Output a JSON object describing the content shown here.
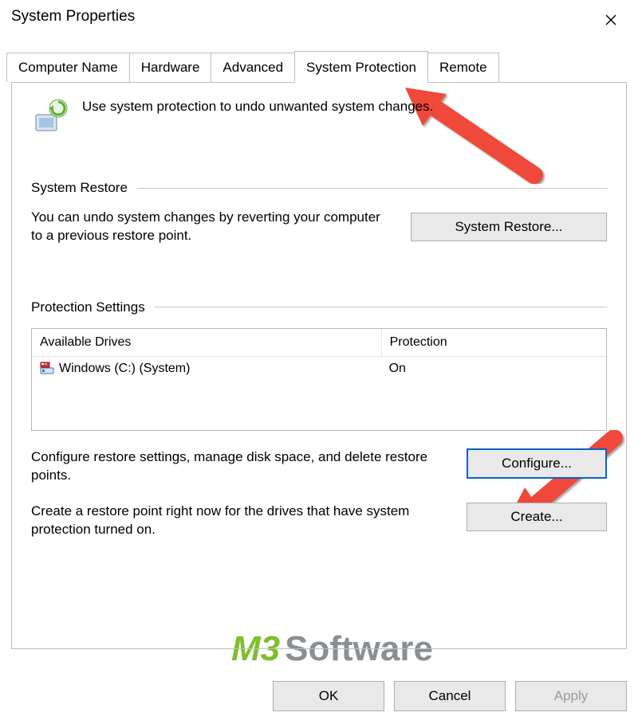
{
  "window": {
    "title": "System Properties",
    "close_icon": "close"
  },
  "tabs": [
    {
      "label": "Computer Name"
    },
    {
      "label": "Hardware"
    },
    {
      "label": "Advanced"
    },
    {
      "label": "System Protection",
      "active": true
    },
    {
      "label": "Remote"
    }
  ],
  "intro_text": "Use system protection to undo unwanted system changes.",
  "groups": {
    "system_restore": {
      "heading": "System Restore",
      "description": "You can undo system changes by reverting your computer to a previous restore point.",
      "button": "System Restore..."
    },
    "protection_settings": {
      "heading": "Protection Settings",
      "columns": {
        "drives": "Available Drives",
        "protection": "Protection"
      },
      "rows": [
        {
          "drive": "Windows (C:) (System)",
          "protection": "On"
        }
      ],
      "configure_desc": "Configure restore settings, manage disk space, and delete restore points.",
      "configure_button": "Configure...",
      "create_desc": "Create a restore point right now for the drives that have system protection turned on.",
      "create_button": "Create..."
    }
  },
  "bottom": {
    "ok": "OK",
    "cancel": "Cancel",
    "apply": "Apply"
  },
  "watermark": {
    "m": "M",
    "three": "3",
    "soft": "Software"
  }
}
